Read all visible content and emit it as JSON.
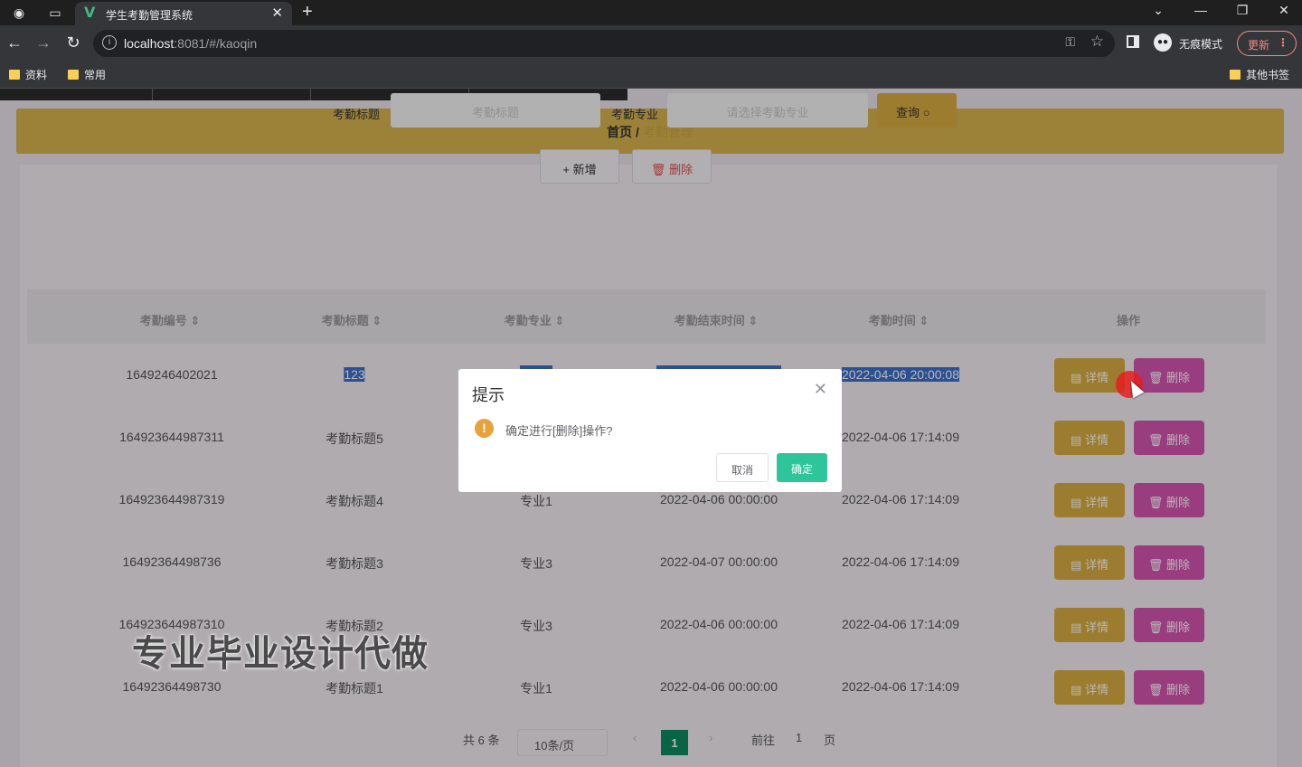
{
  "browser": {
    "tab_title": "学生考勤管理系统",
    "url_host": "localhost",
    "url_rest": ":8081/#/kaoqin",
    "incognito_label": "无痕模式",
    "update_label": "更新",
    "bookmarks": [
      "资料",
      "常用"
    ],
    "other_bookmarks": "其他书签"
  },
  "breadcrumb": {
    "home": "首页",
    "separator": "/",
    "current": "考勤管理"
  },
  "search": {
    "title_label": "考勤标题",
    "title_placeholder": "考勤标题",
    "major_label": "考勤专业",
    "major_placeholder": "请选择考勤专业",
    "query_label": "查询"
  },
  "actions": {
    "add_label": "新增",
    "delete_label": "删除"
  },
  "table": {
    "headers": [
      "考勤编号",
      "考勤标题",
      "考勤专业",
      "考勤结束时间",
      "考勤时间",
      "操作"
    ],
    "detail_label": "详情",
    "delete_label": "删除",
    "rows": [
      {
        "id": "1649246402021",
        "title": "123",
        "major": "",
        "end": "",
        "time": "2022-04-06 20:00:08"
      },
      {
        "id": "164923644987311",
        "title": "考勤标题5",
        "major": "",
        "end": "",
        "time": "2022-04-06 17:14:09"
      },
      {
        "id": "164923644987319",
        "title": "考勤标题4",
        "major": "专业1",
        "end": "2022-04-06 00:00:00",
        "time": "2022-04-06 17:14:09"
      },
      {
        "id": "16492364498736",
        "title": "考勤标题3",
        "major": "专业3",
        "end": "2022-04-07 00:00:00",
        "time": "2022-04-06 17:14:09"
      },
      {
        "id": "164923644987310",
        "title": "考勤标题2",
        "major": "专业3",
        "end": "2022-04-06 00:00:00",
        "time": "2022-04-06 17:14:09"
      },
      {
        "id": "16492364498730",
        "title": "考勤标题1",
        "major": "专业1",
        "end": "2022-04-06 00:00:00",
        "time": "2022-04-06 17:14:09"
      }
    ]
  },
  "pagination": {
    "total": "共 6 条",
    "page_size": "10条/页",
    "current": "1",
    "goto": "前往",
    "goto_value": "1",
    "page_unit": "页"
  },
  "watermark": "专业毕业设计代做",
  "dialog": {
    "title": "提示",
    "message": "确定进行[删除]操作?",
    "cancel": "取消",
    "confirm": "确定"
  },
  "colors": {
    "breadcrumb": "#d8b44e",
    "detail": "#d8ac40",
    "delete": "#d455b0",
    "confirm": "#2fc59a",
    "pager_active": "#0a8c60"
  }
}
